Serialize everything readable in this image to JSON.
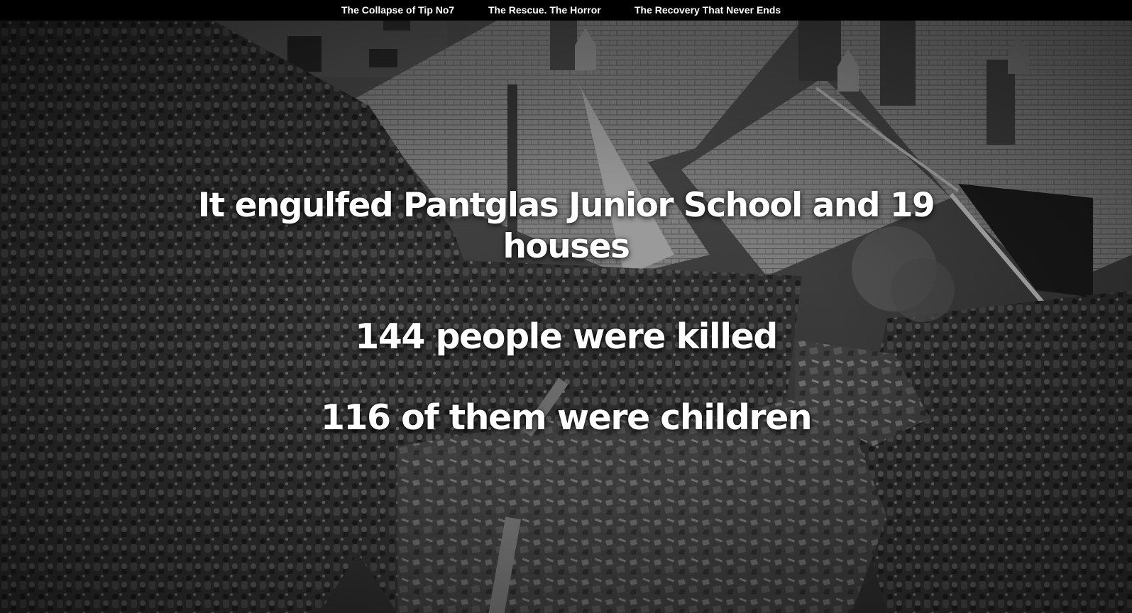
{
  "nav": {
    "items": [
      {
        "label": "The Collapse of Tip No7"
      },
      {
        "label": "The Rescue. The Horror"
      },
      {
        "label": "The Recovery That Never Ends"
      }
    ]
  },
  "hero": {
    "statement_1": "It engulfed Pantglas Junior School and 19 houses",
    "statement_2": "144 people were killed",
    "statement_3": "116 of them were children"
  },
  "colors": {
    "nav_background": "#000000",
    "text": "#ffffff"
  }
}
